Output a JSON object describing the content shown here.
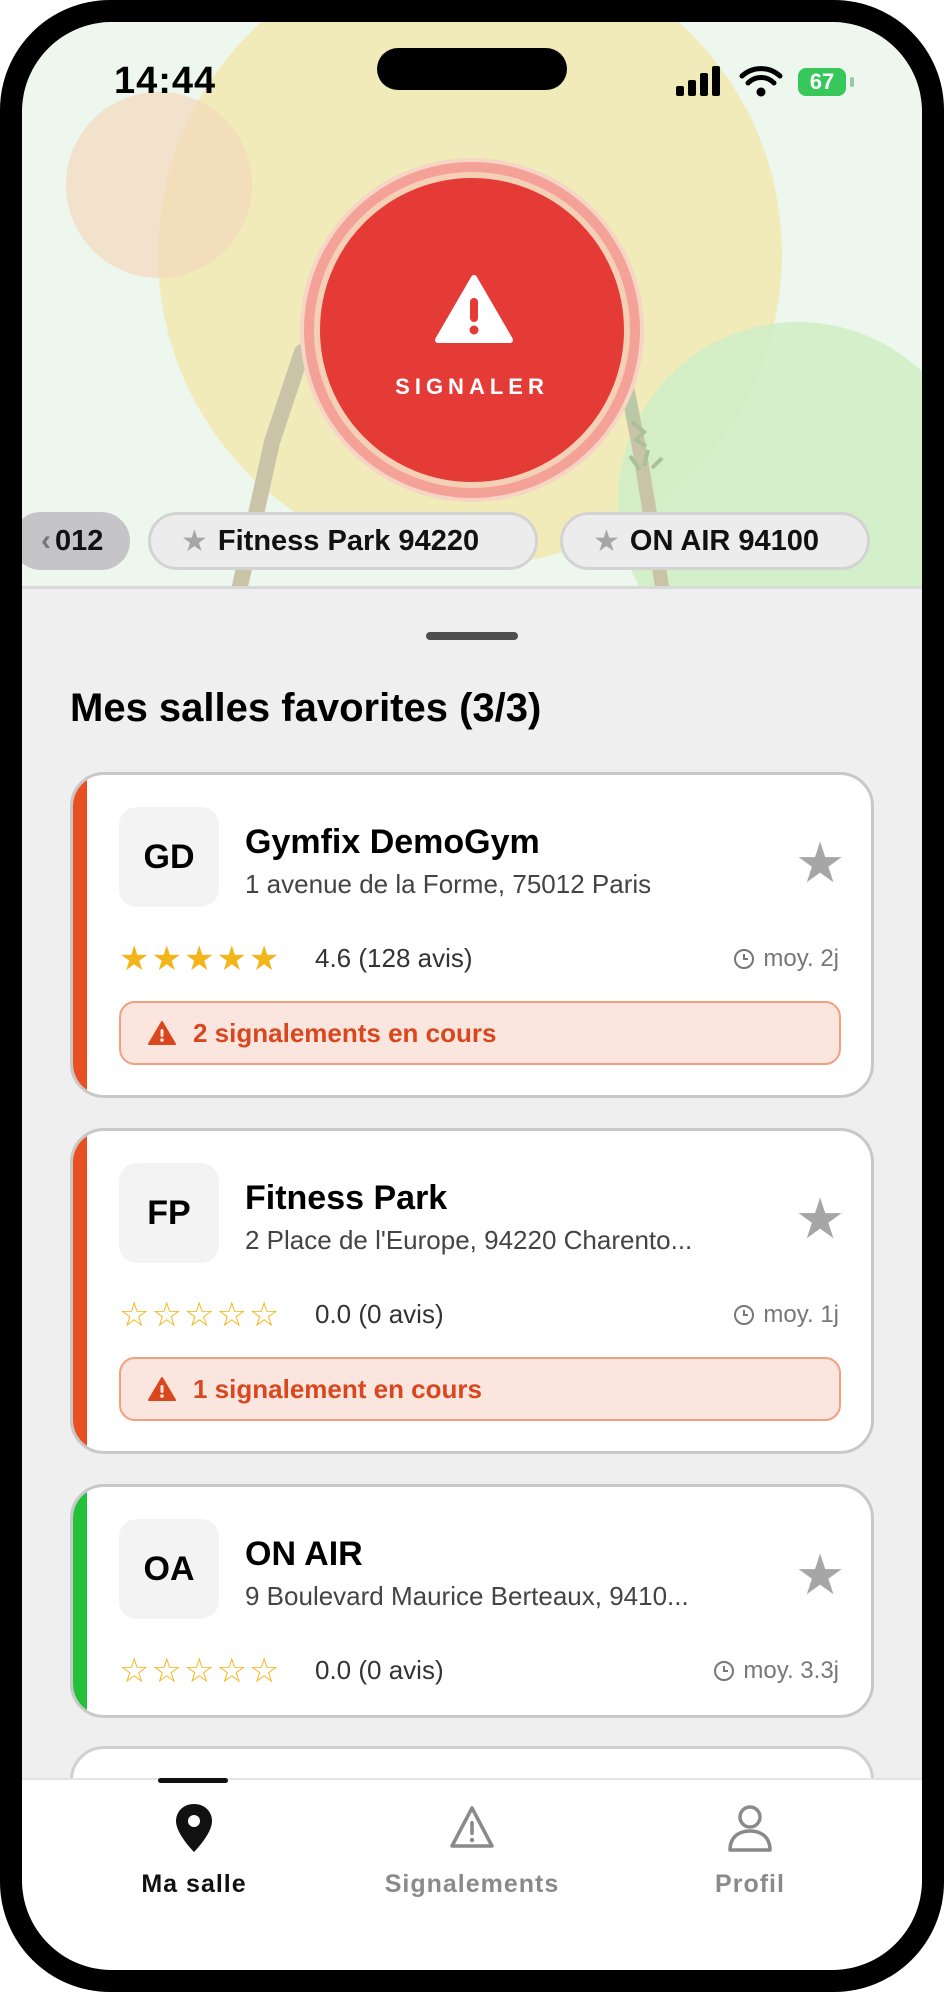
{
  "status_bar": {
    "time": "14:44",
    "battery": "67"
  },
  "hero": {
    "signal_label": "SIGNALER",
    "chips": [
      {
        "label": "012"
      },
      {
        "label": "Fitness Park 94220"
      },
      {
        "label": "ON AIR 94100"
      }
    ]
  },
  "section": {
    "title": "Mes salles favorites (3/3)"
  },
  "gyms": [
    {
      "initials": "GD",
      "name": "Gymfix DemoGym",
      "address": "1 avenue de la Forme, 75012 Paris",
      "stars": "★★★★★",
      "rating_text": "4.6 (128 avis)",
      "avg": "moy. 2j",
      "accent_color": "#e84f22",
      "alert": "2 signalements en cours"
    },
    {
      "initials": "FP",
      "name": "Fitness Park",
      "address": "2 Place de l'Europe, 94220 Charento...",
      "stars": "☆☆☆☆☆",
      "rating_text": "0.0 (0 avis)",
      "avg": "moy. 1j",
      "accent_color": "#e84f22",
      "alert": "1 signalement en cours"
    },
    {
      "initials": "OA",
      "name": "ON AIR",
      "address": "9 Boulevard Maurice Berteaux, 9410...",
      "stars": "☆☆☆☆☆",
      "rating_text": "0.0 (0 avis)",
      "avg": "moy. 3.3j",
      "accent_color": "#23c13a"
    }
  ],
  "tabs": {
    "ma_salle": "Ma salle",
    "signalements": "Signalements",
    "profil": "Profil"
  },
  "colors": {
    "signal_red": "#e53b37",
    "alert_orange": "#d8471d",
    "ok_green": "#23c13a",
    "star_yellow": "#f4b51a"
  },
  "icons": [
    "warning-icon",
    "star-icon",
    "clock-icon",
    "location-pin-icon",
    "user-icon",
    "chevron-left-icon"
  ]
}
